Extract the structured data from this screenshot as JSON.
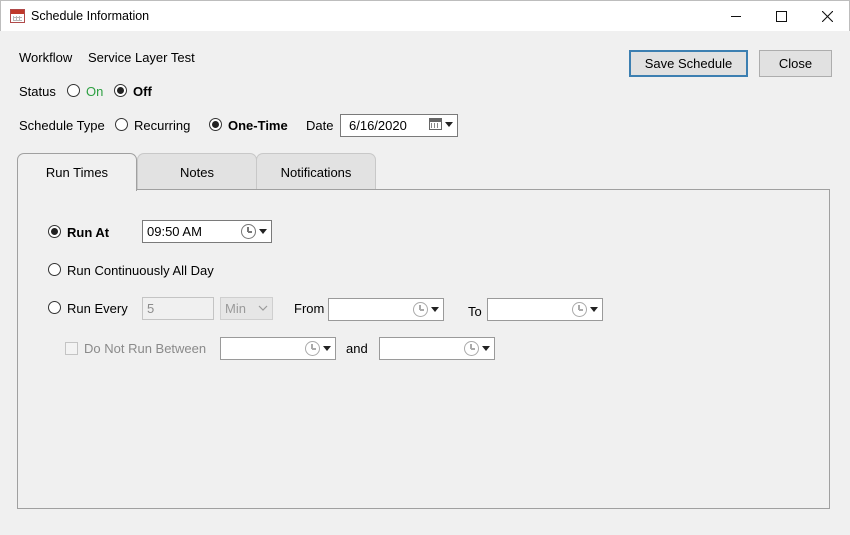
{
  "window": {
    "title": "Schedule Information",
    "icon": "calendar-icon"
  },
  "header": {
    "workflow_label": "Workflow",
    "workflow_value": "Service Layer Test",
    "status_label": "Status",
    "status_on": "On",
    "status_off": "Off",
    "status_selected": "Off",
    "schedule_type_label": "Schedule Type",
    "recurring_label": "Recurring",
    "onetime_label": "One-Time",
    "schedule_type_selected": "One-Time",
    "date_label": "Date",
    "date_value": "6/16/2020"
  },
  "buttons": {
    "save": "Save Schedule",
    "close": "Close"
  },
  "tabs": [
    {
      "label": "Run Times",
      "active": true
    },
    {
      "label": "Notes",
      "active": false
    },
    {
      "label": "Notifications",
      "active": false
    }
  ],
  "run_times": {
    "run_at_label": "Run At",
    "run_at_value": "09:50 AM",
    "run_continuously_label": "Run Continuously All Day",
    "run_every_label": "Run Every",
    "run_every_value": "5",
    "run_every_unit": "Min",
    "from_label": "From",
    "from_value": "",
    "to_label": "To",
    "to_value": "",
    "do_not_run_label": "Do Not Run Between",
    "do_not_run_checked": false,
    "between_start": "",
    "and_label": "and",
    "between_end": "",
    "selected_option": "Run At"
  },
  "colors": {
    "on_text": "#2ea043",
    "default_button_border": "#3c7fb1"
  }
}
